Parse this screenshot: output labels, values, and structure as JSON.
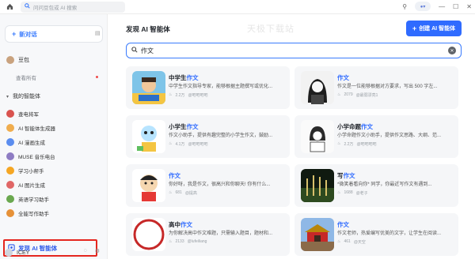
{
  "titlebar": {
    "search_placeholder": "问问豆包或 AI 搜索"
  },
  "sidebar": {
    "new_chat": "新对话",
    "doubao": "豆包",
    "view_all": "查看所有",
    "my_bots_header": "我的智能体",
    "bots": [
      {
        "label": "查电将军",
        "color": "#d9534f"
      },
      {
        "label": "AI 智能体生成器",
        "color": "#f0ad4e"
      },
      {
        "label": "AI 漫画生成",
        "color": "#5b8def"
      },
      {
        "label": "MUSE 音乐电台",
        "color": "#8e7cc3"
      },
      {
        "label": "学习小帮手",
        "color": "#f5a623"
      },
      {
        "label": "AI 图片生成",
        "color": "#e06666"
      },
      {
        "label": "英语学习助手",
        "color": "#6aa84f"
      },
      {
        "label": "全能写作助手",
        "color": "#e69138"
      }
    ],
    "discover": "发现 AI 智能体",
    "user_name": "ICEY"
  },
  "main": {
    "title": "发现 AI 智能体",
    "watermark": "天极下载站",
    "create_button": "创建 AI 智能体",
    "search_value": "作文",
    "cards": [
      {
        "title_pre": "中学生",
        "title_hl": "作文",
        "desc": "中学生作文指导专家，能够根据主题撰写或优化...",
        "count": "2.2万",
        "author": "@吧吧吧吧"
      },
      {
        "title_pre": "",
        "title_hl": "作文",
        "desc": "作文是一位能够根据对方要求，写出 500 字左...",
        "count": "2079",
        "author": "@最弱漂亮1"
      },
      {
        "title_pre": "小学生",
        "title_hl": "作文",
        "desc": "作文小助手，提供有趣完整的小学生作文，鼓励...",
        "count": "4.1万",
        "author": "@吧吧吧吧"
      },
      {
        "title_pre": "小学命题",
        "title_hl": "作文",
        "desc": "小学命题作文小助手，提供作文思路、大纲、范...",
        "count": "2.2万",
        "author": "@吧吧吧吧"
      },
      {
        "title_pre": "",
        "title_hl": "作文",
        "desc": "你好呀，我是作文，很高兴和你聊天! 你有什么...",
        "count": "681",
        "author": "@提高"
      },
      {
        "title_pre": "写",
        "title_hl": "作文",
        "desc": "*微笑着看向你* 同学，你最近写作文有遇到...",
        "count": "1688",
        "author": "@老子"
      },
      {
        "title_pre": "高中",
        "title_hl": "作文",
        "desc": "为你解决高中作文难题，只需输入题目，题材和...",
        "count": "2133",
        "author": "@lufeiliang"
      },
      {
        "title_pre": "",
        "title_hl": "作文",
        "desc": "作文老师，热爱编写优美的文字，让学生在阅读...",
        "count": "461",
        "author": "@天空"
      }
    ]
  }
}
